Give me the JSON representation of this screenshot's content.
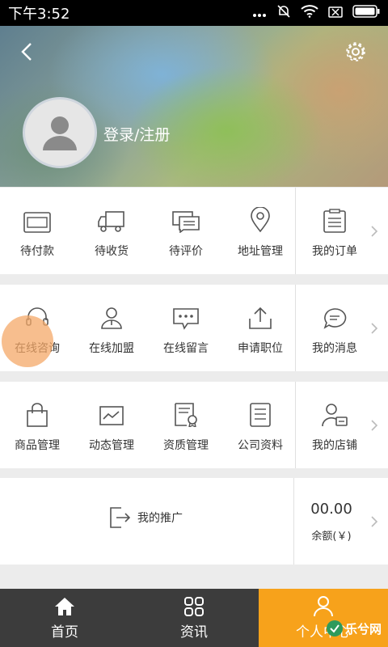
{
  "status_bar": {
    "time": "下午3:52"
  },
  "profile": {
    "login_text": "登录/注册"
  },
  "orders": [
    {
      "label": "待付款",
      "icon": "wallet-icon"
    },
    {
      "label": "待收货",
      "icon": "truck-icon"
    },
    {
      "label": "待评价",
      "icon": "chat-icon"
    },
    {
      "label": "地址管理",
      "icon": "location-pin-icon"
    },
    {
      "label": "我的订单",
      "icon": "clipboard-icon"
    }
  ],
  "services": [
    {
      "label": "在线咨询",
      "icon": "headset-icon"
    },
    {
      "label": "在线加盟",
      "icon": "person-icon"
    },
    {
      "label": "在线留言",
      "icon": "message-dots-icon"
    },
    {
      "label": "申请职位",
      "icon": "upload-icon"
    },
    {
      "label": "我的消息",
      "icon": "speech-bubble-icon"
    }
  ],
  "management": [
    {
      "label": "商品管理",
      "icon": "shopping-bag-icon"
    },
    {
      "label": "动态管理",
      "icon": "trend-icon"
    },
    {
      "label": "资质管理",
      "icon": "certificate-icon"
    },
    {
      "label": "公司资料",
      "icon": "document-list-icon"
    },
    {
      "label": "我的店铺",
      "icon": "shop-owner-icon"
    }
  ],
  "promotion": {
    "label": "我的推广",
    "icon": "share-arrow-icon"
  },
  "balance": {
    "amount": "00.00",
    "caption": "余额(￥)"
  },
  "bottom_nav": [
    {
      "label": "首页",
      "icon": "home-icon"
    },
    {
      "label": "资讯",
      "icon": "grid-icon"
    },
    {
      "label": "个人中心",
      "icon": "user-icon"
    }
  ],
  "watermark": {
    "text": "乐兮网"
  },
  "colors": {
    "accent": "#f7a21b",
    "nav_bg": "#3c3c3c",
    "highlight": "#f4a868"
  }
}
